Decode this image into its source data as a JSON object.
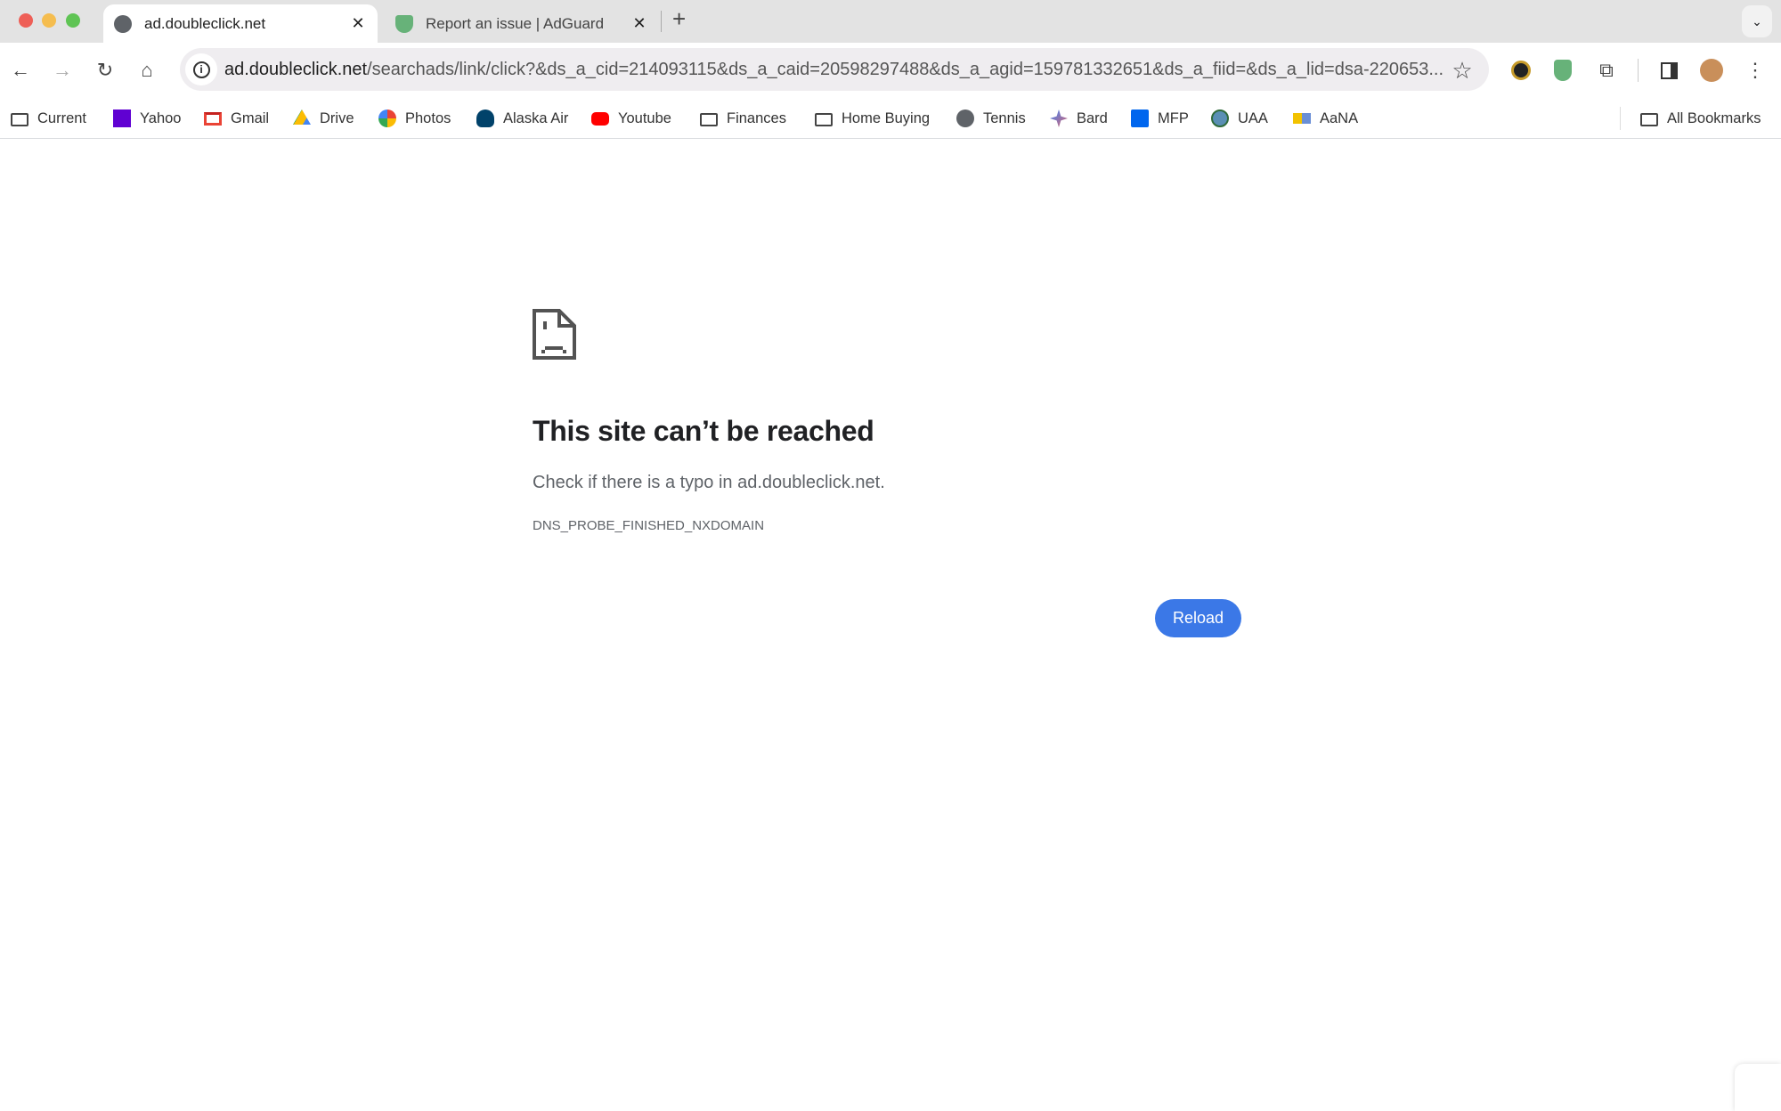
{
  "tabs": [
    {
      "title": "ad.doubleclick.net",
      "active": true,
      "icon": "globe-icon"
    },
    {
      "title": "Report an issue | AdGuard",
      "active": false,
      "icon": "adguard-shield-icon"
    }
  ],
  "new_tab_label": "+",
  "close_label": "✕",
  "address_bar": {
    "host": "ad.doubleclick.net",
    "path": "/searchads/link/click?&ds_a_cid=214093115&ds_a_caid=20598297488&ds_a_agid=159781332651&ds_a_fiid=&ds_a_lid=dsa-220653..."
  },
  "bookmarks": [
    {
      "label": "Current",
      "icon": "folder-icon"
    },
    {
      "label": "Yahoo",
      "icon": "yahoo-icon"
    },
    {
      "label": "Gmail",
      "icon": "gmail-icon"
    },
    {
      "label": "Drive",
      "icon": "drive-icon"
    },
    {
      "label": "Photos",
      "icon": "photos-icon"
    },
    {
      "label": "Alaska Air",
      "icon": "alaska-air-icon"
    },
    {
      "label": "Youtube",
      "icon": "youtube-icon"
    },
    {
      "label": "Finances",
      "icon": "folder-icon"
    },
    {
      "label": "Home Buying",
      "icon": "folder-icon"
    },
    {
      "label": "Tennis",
      "icon": "globe-icon"
    },
    {
      "label": "Bard",
      "icon": "bard-icon"
    },
    {
      "label": "MFP",
      "icon": "mfp-icon"
    },
    {
      "label": "UAA",
      "icon": "uaa-icon"
    },
    {
      "label": "AaNA",
      "icon": "aana-icon"
    }
  ],
  "all_bookmarks": "All Bookmarks",
  "error": {
    "title": "This site can’t be reached",
    "description": "Check if there is a typo in ad.doubleclick.net.",
    "code": "DNS_PROBE_FINISHED_NXDOMAIN",
    "reload_label": "Reload"
  },
  "colors": {
    "accent": "#3b78e7",
    "tabstrip": "#e3e3e3",
    "omnibox": "#efedf0"
  }
}
